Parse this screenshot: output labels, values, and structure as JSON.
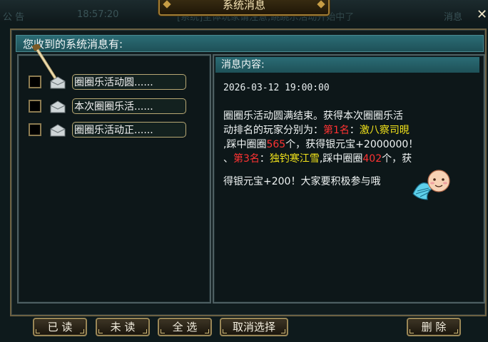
{
  "window": {
    "title": "系统消息",
    "close_icon": "close-icon"
  },
  "background": {
    "label_1": "公 告",
    "label_2": "18:57:20",
    "label_3": "[系统]全体玩家请注意,跳跳乐活动开始中了",
    "label_4": "消息"
  },
  "list": {
    "header": "您收到的系统消息有:",
    "items": [
      {
        "title": "圈圈乐活动圆......"
      },
      {
        "title": "本次圈圈乐活......"
      },
      {
        "title": "圈圈乐活动正......"
      }
    ]
  },
  "detail": {
    "header": "消息内容:",
    "timestamp": "2026-03-12 19:00:00",
    "line1": "圈圈乐活动圆满结束。获得本次圈圈乐活",
    "line2_a": "动排名的玩家分别为：",
    "line2_rank1": "第1名",
    "line2_colon": "：",
    "line2_player1": "激八察司晛",
    "line3_a": ",踩中圈圈",
    "line3_count1": "565",
    "line3_b": "个，获得银元宝+2000000！",
    "line4_a": "、",
    "line4_rank3": "第3名",
    "line4_colon": "：",
    "line4_player3": "独钓寒江雪",
    "line4_b": ",踩中圈圈",
    "line4_count3": "402",
    "line4_c": "个，获",
    "line5": "得银元宝+200！大家要积极参与哦"
  },
  "buttons": {
    "read": "已 读",
    "unread": "未 读",
    "select_all": "全 选",
    "deselect": "取消选择",
    "delete": "删 除"
  },
  "colors": {
    "accent_teal": "#2b6c75",
    "rank_red": "#ff3333",
    "player_yellow": "#f2e31a",
    "gold_border": "#9a8757"
  }
}
